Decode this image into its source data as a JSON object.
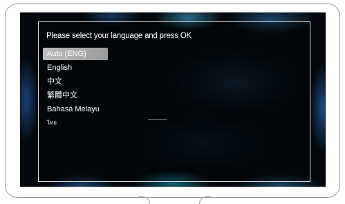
{
  "dialog": {
    "title": "Please select your language and press OK",
    "languages": [
      {
        "label": "Auto (ENG)",
        "selected": true
      },
      {
        "label": "English",
        "selected": false
      },
      {
        "label": "中文",
        "selected": false
      },
      {
        "label": "繁體中文",
        "selected": false
      },
      {
        "label": "Bahasa Melayu",
        "selected": false
      },
      {
        "label": "ไทย",
        "selected": false
      }
    ]
  },
  "colors": {
    "screen_background": "#04080c",
    "highlight": "#b0b0b0",
    "text": "#ffffff"
  }
}
